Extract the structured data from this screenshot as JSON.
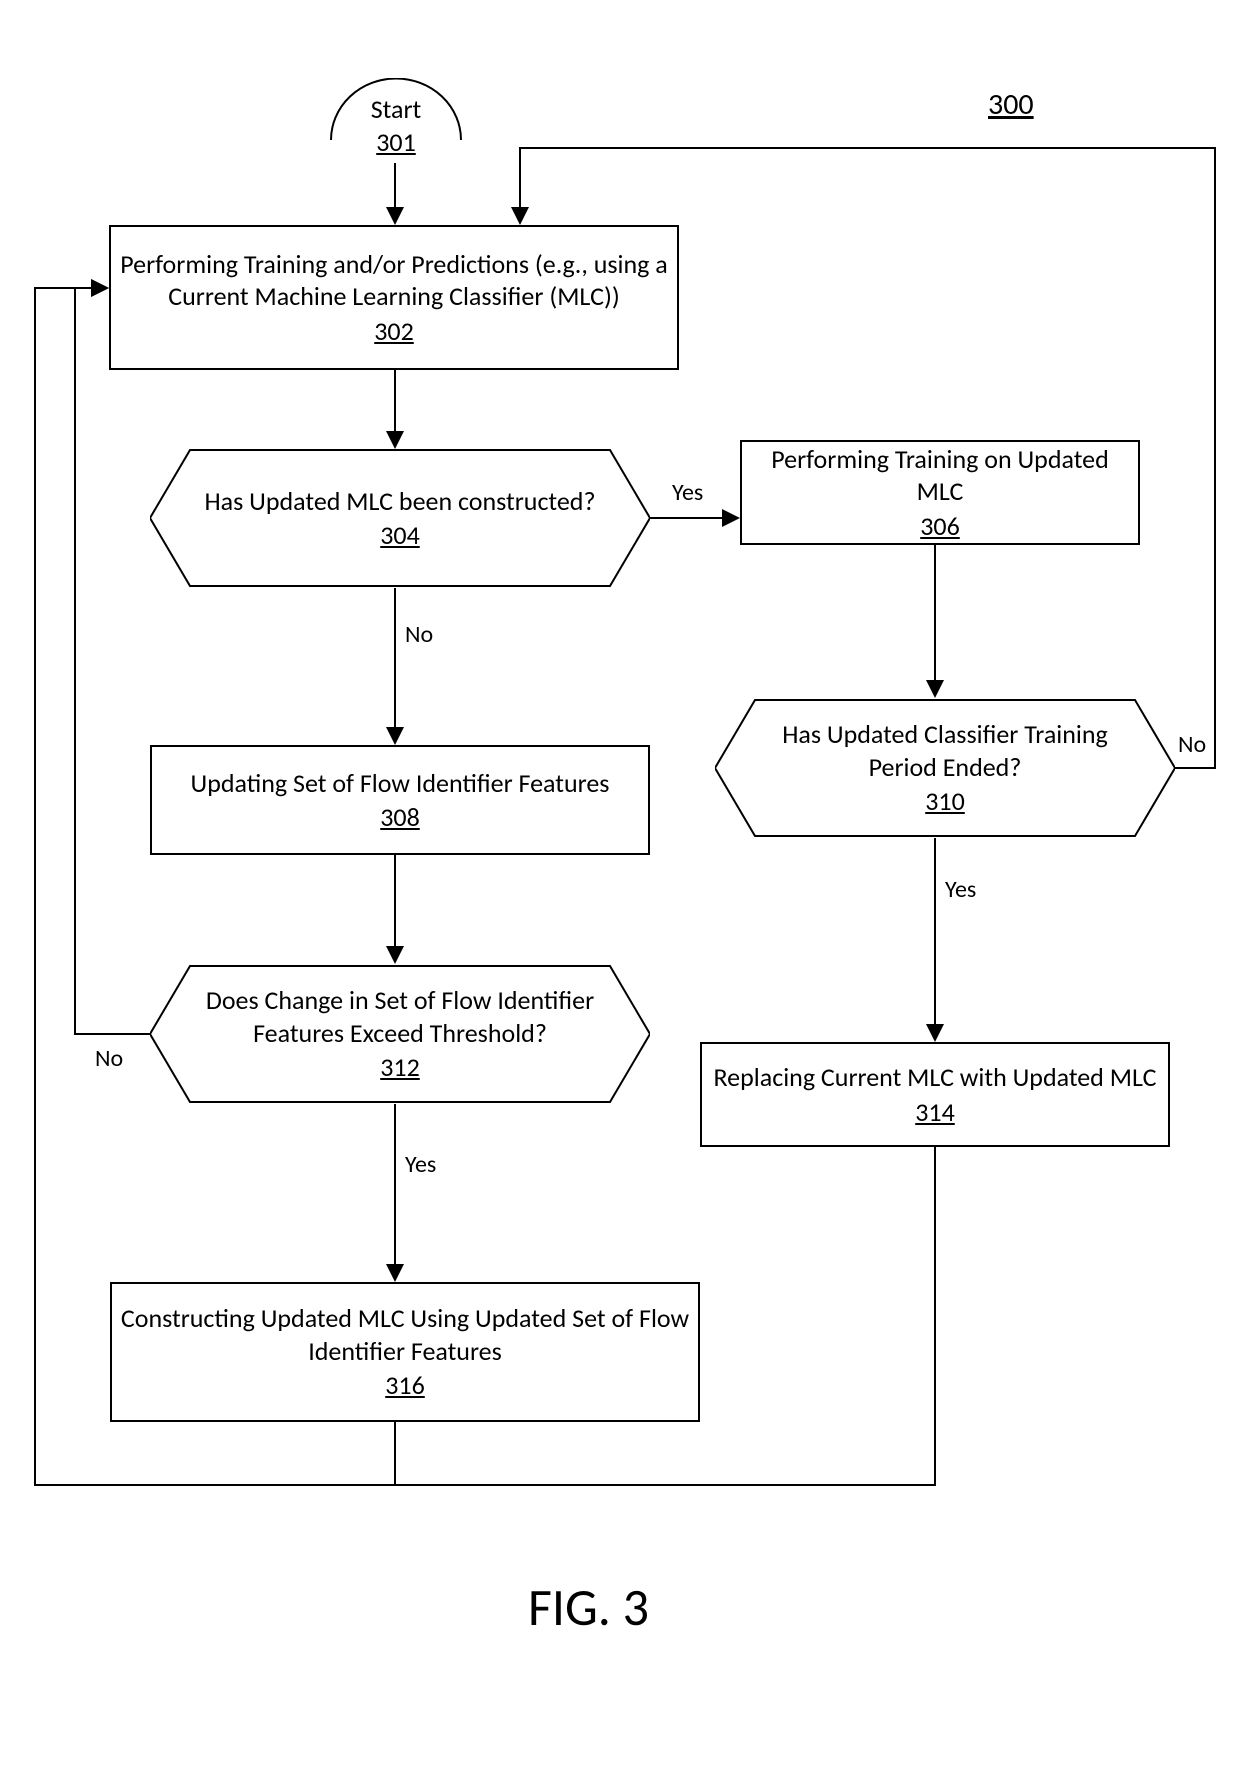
{
  "figure_caption": "FIG. 3",
  "page_ref": "300",
  "nodes": {
    "start": {
      "label": "Start",
      "ref": "301"
    },
    "n302": {
      "label": "Performing Training and/or Predictions (e.g., using a Current Machine Learning Classifier (MLC))",
      "ref": "302"
    },
    "n304": {
      "label": "Has Updated MLC been constructed?",
      "ref": "304"
    },
    "n306": {
      "label": "Performing Training on Updated MLC",
      "ref": "306"
    },
    "n308": {
      "label": "Updating Set of Flow Identifier Features",
      "ref": "308"
    },
    "n310": {
      "label": "Has Updated Classifier Training Period Ended?",
      "ref": "310"
    },
    "n312": {
      "label": "Does Change in Set of Flow Identifier Features Exceed Threshold?",
      "ref": "312"
    },
    "n314": {
      "label": "Replacing Current MLC with Updated MLC",
      "ref": "314"
    },
    "n316": {
      "label": "Constructing Updated MLC Using Updated Set of Flow Identifier Features",
      "ref": "316"
    }
  },
  "edge_labels": {
    "yes_304": "Yes",
    "no_304": "No",
    "yes_310": "Yes",
    "no_310": "No",
    "yes_312": "Yes",
    "no_312": "No"
  }
}
